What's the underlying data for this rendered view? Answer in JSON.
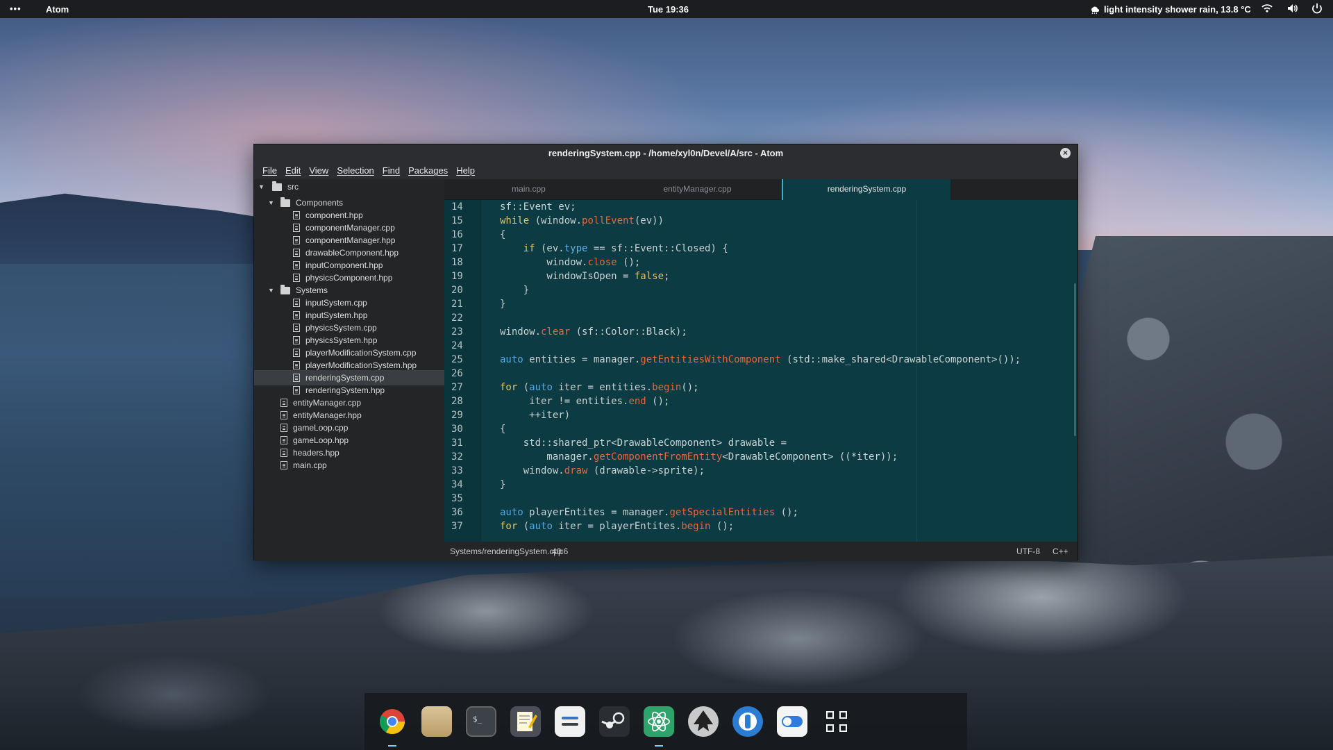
{
  "top_panel": {
    "menu_dots": "•••",
    "app_name": "Atom",
    "clock": "Tue 19:36",
    "weather": "light intensity shower rain, 13.8 °C"
  },
  "window": {
    "title": "renderingSystem.cpp - /home/xyl0n/Devel/A/src - Atom",
    "close_glyph": "×",
    "menu": [
      "File",
      "Edit",
      "View",
      "Selection",
      "Find",
      "Packages",
      "Help"
    ]
  },
  "tree": {
    "root": "src",
    "folders": {
      "components": {
        "label": "Components",
        "files": [
          "component.hpp",
          "componentManager.cpp",
          "componentManager.hpp",
          "drawableComponent.hpp",
          "inputComponent.hpp",
          "physicsComponent.hpp"
        ]
      },
      "systems": {
        "label": "Systems",
        "files": [
          "inputSystem.cpp",
          "inputSystem.hpp",
          "physicsSystem.cpp",
          "physicsSystem.hpp",
          "playerModificationSystem.cpp",
          "playerModificationSystem.hpp",
          "renderingSystem.cpp",
          "renderingSystem.hpp"
        ]
      }
    },
    "root_files": [
      "entityManager.cpp",
      "entityManager.hpp",
      "gameLoop.cpp",
      "gameLoop.hpp",
      "headers.hpp",
      "main.cpp"
    ],
    "selected_file": "renderingSystem.cpp"
  },
  "tabs": [
    "main.cpp",
    "entityManager.cpp",
    "renderingSystem.cpp"
  ],
  "active_tab": "renderingSystem.cpp",
  "editor": {
    "line_numbers": [
      "14",
      "15",
      "16",
      "17",
      "18",
      "19",
      "20",
      "21",
      "22",
      "23",
      "24",
      "25",
      "26",
      "27",
      "28",
      "29",
      "30",
      "31",
      "32",
      "33",
      "34",
      "35",
      "36",
      "37"
    ],
    "lines": [
      "sf::Event ev;",
      "while (window.pollEvent(ev))",
      "{",
      "    if (ev.type == sf::Event::Closed) {",
      "        window.close ();",
      "        windowIsOpen = false;",
      "    }",
      "}",
      "",
      "window.clear (sf::Color::Black);",
      "",
      "auto entities = manager.getEntitiesWithComponent (std::make_shared<DrawableComponent>());",
      "",
      "for (auto iter = entities.begin();",
      "     iter != entities.end ();",
      "     ++iter)",
      "{",
      "    std::shared_ptr<DrawableComponent> drawable =",
      "        manager.getComponentFromEntity<DrawableComponent> ((*iter));",
      "    window.draw (drawable->sprite);",
      "}",
      "",
      "auto playerEntites = manager.getSpecialEntities ();",
      "for (auto iter = playerEntites.begin ();"
    ]
  },
  "status": {
    "path": "Systems/renderingSystem.cpp",
    "cursor": "40:6",
    "encoding": "UTF-8",
    "grammar": "C++"
  },
  "dock": {
    "items": [
      "chrome-icon",
      "files-icon",
      "terminal-icon",
      "text-editor-icon",
      "settings-icon",
      "steam-icon",
      "atom-icon",
      "inkscape-icon",
      "keepassx-icon",
      "toggle-icon",
      "app-grid-icon"
    ],
    "terminal_prompt": "$_"
  },
  "colors": {
    "editor_bg": "#0c3b43",
    "keyword": "#e2c36b",
    "function": "#e6683d",
    "type": "#53a8e0",
    "active_tab_accent": "#29b6d1"
  }
}
